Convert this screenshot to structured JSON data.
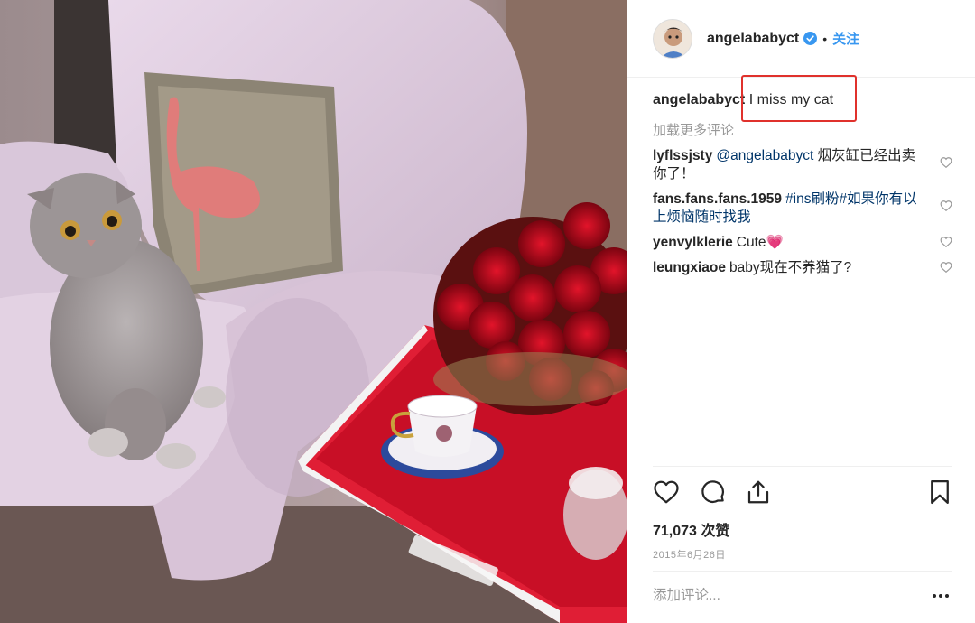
{
  "post": {
    "username": "angelababyct",
    "verified": true,
    "separator": "•",
    "follow_label": "关注",
    "caption_user": "angelababyct",
    "caption_text": "I miss my cat",
    "load_more": "加载更多评论",
    "comments": [
      {
        "user": "lyflssjsty",
        "mention": "@angelababyct",
        "text": " 烟灰缸已经出卖你了！"
      },
      {
        "user": "fans.fans.fans.1959",
        "tag": "#ins刷粉#如果你有以上烦恼随时找我",
        "text": ""
      },
      {
        "user": "yenvylklerie",
        "text": "Cute💗"
      },
      {
        "user": "leungxiaoe",
        "text": "baby现在不养猫了?"
      }
    ],
    "likes": "71,073 次赞",
    "date": "2015年6月26日",
    "add_comment_placeholder": "添加评论...",
    "icons": [
      "heart-icon",
      "comment-icon",
      "share-icon",
      "bookmark-icon",
      "more-options-icon",
      "verified-badge-icon"
    ],
    "colors": {
      "link": "#3897f0",
      "highlight_box": "#e0312c",
      "muted": "#999999"
    }
  }
}
